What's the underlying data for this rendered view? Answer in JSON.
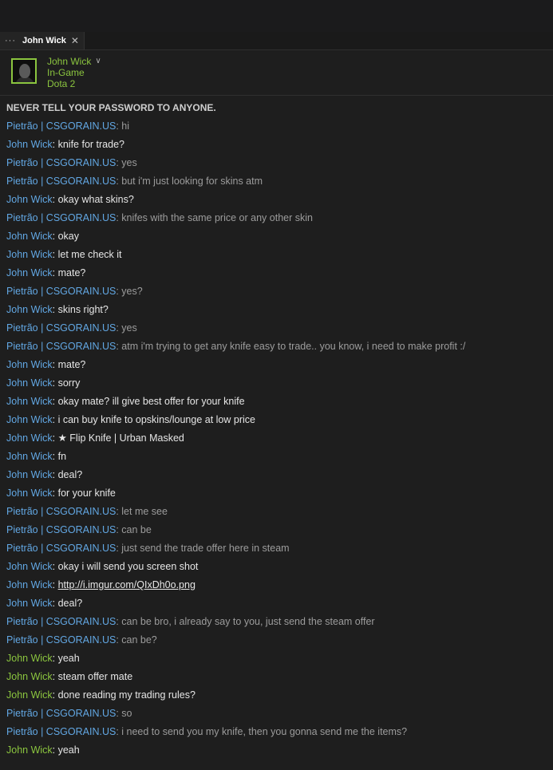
{
  "tab": {
    "menu": "···",
    "title": "John Wick",
    "close": "✕"
  },
  "friend": {
    "name": "John Wick",
    "status": "In-Game",
    "game": "Dota 2"
  },
  "warning": "NEVER TELL YOUR PASSWORD TO ANYONE.",
  "colors": {
    "friend_blue": "#62a7e3",
    "ingame_green": "#8bc53f"
  },
  "messages": [
    {
      "sender": "Pietrão | CSGORAIN.US",
      "text": "hi",
      "from": "them"
    },
    {
      "sender": "John Wick",
      "text": "knife for trade?",
      "from": "me"
    },
    {
      "sender": "Pietrão | CSGORAIN.US",
      "text": "yes",
      "from": "them"
    },
    {
      "sender": "Pietrão | CSGORAIN.US",
      "text": "but i'm just looking for skins atm",
      "from": "them"
    },
    {
      "sender": "John Wick",
      "text": "okay what skins?",
      "from": "me"
    },
    {
      "sender": "Pietrão | CSGORAIN.US",
      "text": "knifes with the same price or any other skin",
      "from": "them"
    },
    {
      "sender": "John Wick",
      "text": "okay",
      "from": "me"
    },
    {
      "sender": "John Wick",
      "text": "let me check it",
      "from": "me"
    },
    {
      "sender": "John Wick",
      "text": "mate?",
      "from": "me"
    },
    {
      "sender": "Pietrão | CSGORAIN.US",
      "text": "yes?",
      "from": "them"
    },
    {
      "sender": "John Wick",
      "text": "skins right?",
      "from": "me"
    },
    {
      "sender": "Pietrão | CSGORAIN.US",
      "text": "yes",
      "from": "them"
    },
    {
      "sender": "Pietrão | CSGORAIN.US",
      "text": "atm i'm trying to get any knife easy to trade.. you know, i need to make profit :/",
      "from": "them"
    },
    {
      "sender": "John Wick",
      "text": "mate?",
      "from": "me"
    },
    {
      "sender": "John Wick",
      "text": "sorry",
      "from": "me"
    },
    {
      "sender": "John Wick",
      "text": "okay mate? ill give best offer for your knife",
      "from": "me"
    },
    {
      "sender": "John Wick",
      "text": "i can buy knife to opskins/lounge at low price",
      "from": "me"
    },
    {
      "sender": "John Wick",
      "text": "★ Flip Knife | Urban Masked",
      "from": "me"
    },
    {
      "sender": "John Wick",
      "text": "fn",
      "from": "me"
    },
    {
      "sender": "John Wick",
      "text": "deal?",
      "from": "me"
    },
    {
      "sender": "John Wick",
      "text": "for your knife",
      "from": "me"
    },
    {
      "sender": "Pietrão | CSGORAIN.US",
      "text": "let me see",
      "from": "them"
    },
    {
      "sender": "Pietrão | CSGORAIN.US",
      "text": "can be",
      "from": "them"
    },
    {
      "sender": "Pietrão | CSGORAIN.US",
      "text": "just send the trade offer here in steam",
      "from": "them"
    },
    {
      "sender": "John Wick",
      "text": "okay i will send you screen shot",
      "from": "me"
    },
    {
      "sender": "John Wick",
      "text": "http://i.imgur.com/QIxDh0o.png",
      "from": "me",
      "link": true
    },
    {
      "sender": "John Wick",
      "text": "deal?",
      "from": "me"
    },
    {
      "sender": "Pietrão | CSGORAIN.US",
      "text": "can be bro, i already say to you, just send the steam offer",
      "from": "them"
    },
    {
      "sender": "Pietrão | CSGORAIN.US",
      "text": "can be?",
      "from": "them"
    },
    {
      "sender": "John Wick",
      "text": "yeah",
      "from": "me",
      "green": true
    },
    {
      "sender": "John Wick",
      "text": "steam offer mate",
      "from": "me",
      "green": true
    },
    {
      "sender": "John Wick",
      "text": "done reading my trading rules?",
      "from": "me",
      "green": true
    },
    {
      "sender": "Pietrão | CSGORAIN.US",
      "text": "so",
      "from": "them"
    },
    {
      "sender": "Pietrão | CSGORAIN.US",
      "text": "i need to send you my knife, then you gonna send me the items?",
      "from": "them"
    },
    {
      "sender": "John Wick",
      "text": "yeah",
      "from": "me",
      "green": true
    }
  ]
}
